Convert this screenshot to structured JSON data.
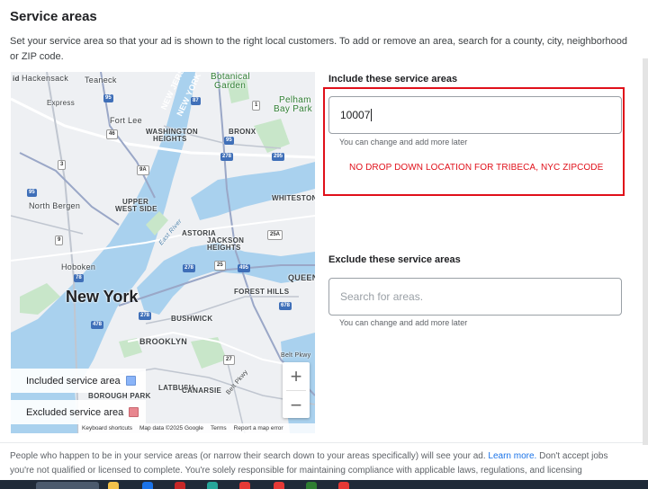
{
  "header": {
    "title": "Service areas",
    "description": "Set your service area so that your ad is shown to the right local customers. To add or remove an area, search for a county, city, neighborhood or ZIP code."
  },
  "map": {
    "labels": {
      "hackensack": "Hackensack",
      "teaneck": "Teaneck",
      "express": "Express",
      "botanical": "Botanical",
      "garden": "Garden",
      "pelham": "Pelham",
      "bay_park": "Bay Park",
      "fort_lee": "Fort Lee",
      "washington": "WASHINGTON",
      "heights": "HEIGHTS",
      "bronx": "BRONX",
      "north_bergen": "North Bergen",
      "upper": "UPPER",
      "west_side": "WEST SIDE",
      "whitestone": "WHITESTONE",
      "astoria": "ASTORIA",
      "jackson": "JACKSON",
      "jackson_heights": "HEIGHTS",
      "hoboken": "Hoboken",
      "new_york": "New York",
      "queens": "QUEEN",
      "forest_hills": "FOREST HILLS",
      "bushwick": "BUSHWICK",
      "brooklyn": "BROOKLYN",
      "borough_park": "BOROUGH PARK",
      "flatbush": "LATBUSH",
      "canarsie": "CANARSIE",
      "belt_pkwy": "Belt Pkwy",
      "belt_pkwy2": "Belt Pkwy",
      "east_river": "East River",
      "newjersey": "NEW JERS",
      "newyork_thruway": "NEW YORK",
      "id_edge": "id"
    },
    "highways": [
      "95",
      "87",
      "1",
      "46",
      "95",
      "278",
      "295",
      "9A",
      "3",
      "95",
      "9",
      "278",
      "25",
      "495",
      "25A",
      "78",
      "278",
      "478",
      "678",
      "27"
    ],
    "legend": {
      "included_label": "Included service area",
      "excluded_label": "Excluded service area",
      "included_color": "#8ab4f8",
      "excluded_color": "#e8868f"
    },
    "zoom": {
      "in": "+",
      "out": "−"
    },
    "attribution": {
      "shortcuts": "Keyboard shortcuts",
      "map_data": "Map data ©2025 Google",
      "terms": "Terms",
      "report": "Report a map error"
    }
  },
  "include": {
    "label": "Include these service areas",
    "value": "10007",
    "helper": "You can change and add more later"
  },
  "annotation": {
    "text": "NO DROP DOWN LOCATION FOR TRIBECA, NYC ZIPCODE",
    "color": "#e0101a"
  },
  "exclude": {
    "label": "Exclude these service areas",
    "placeholder": "Search for areas.",
    "helper": "You can change and add more later"
  },
  "footer": {
    "text_before": "People who happen to be in your service areas (or narrow their search down to your areas specifically) will see your ad. ",
    "link": "Learn more.",
    "text_after": " Don't accept jobs you're not qualified or licensed to complete. You're solely responsible for maintaining compliance with applicable laws, regulations, and licensing requirements in each"
  },
  "colors": {
    "accent": "#1a73e8",
    "water": "#a9d1ee",
    "park": "#c8e6c9",
    "highway": "#3f6fb8"
  }
}
